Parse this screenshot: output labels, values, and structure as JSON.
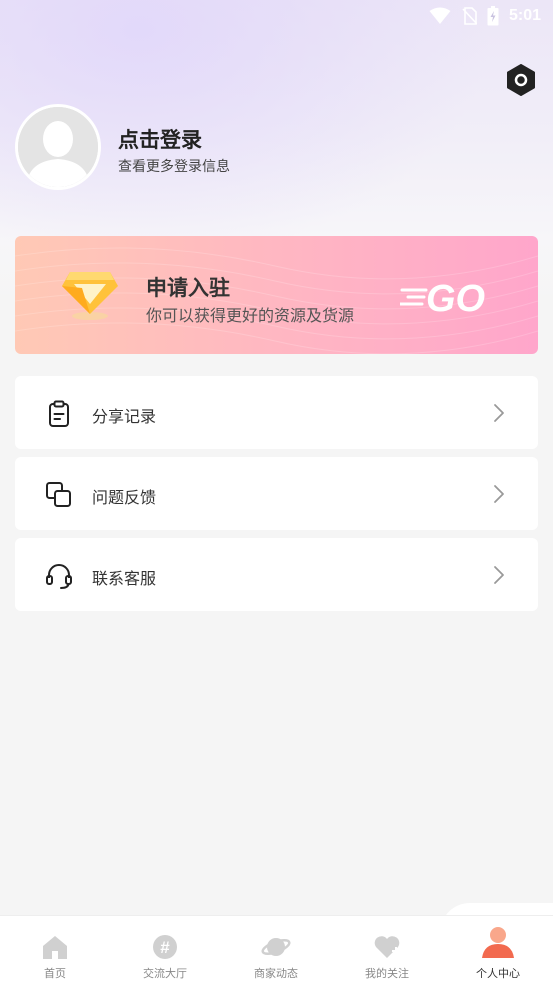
{
  "status_bar": {
    "time": "5:01"
  },
  "profile": {
    "title": "点击登录",
    "subtitle": "查看更多登录信息"
  },
  "banner": {
    "title": "申请入驻",
    "subtitle": "你可以获得更好的资源及货源",
    "go_text": "GO"
  },
  "menu": [
    {
      "label": "分享记录",
      "icon": "clipboard-icon"
    },
    {
      "label": "问题反馈",
      "icon": "overlap-squares-icon"
    },
    {
      "label": "联系客服",
      "icon": "headset-icon"
    }
  ],
  "tabs": [
    {
      "label": "首页",
      "icon": "home-icon",
      "active": false
    },
    {
      "label": "交流大厅",
      "icon": "hashtag-icon",
      "active": false
    },
    {
      "label": "商家动态",
      "icon": "planet-icon",
      "active": false
    },
    {
      "label": "我的关注",
      "icon": "heart-plus-icon",
      "active": false
    },
    {
      "label": "个人中心",
      "icon": "person-icon",
      "active": true
    }
  ],
  "colors": {
    "accent": "#f26a4f",
    "tab_inactive": "#cccccc",
    "banner_start": "#ffc9b5",
    "banner_end": "#ffa6cb"
  }
}
